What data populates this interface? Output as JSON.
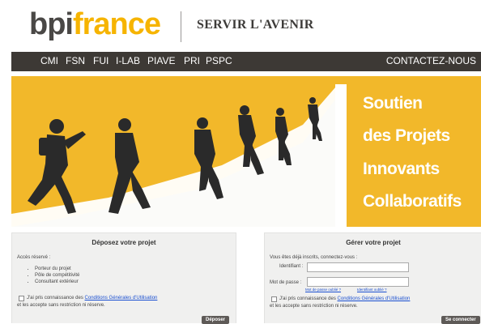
{
  "header": {
    "logo_bpi": "bpi",
    "logo_france": "france",
    "tagline": "SERVIR L'AVENIR"
  },
  "nav": {
    "items": [
      "CMI",
      "FSN",
      "FUI",
      "I-LAB",
      "PIAVE",
      "PRI",
      "PSPC"
    ],
    "contact": "CONTACTEZ-NOUS"
  },
  "banner": {
    "lines": [
      "Soutien",
      "des Projets",
      "Innovants",
      "Collaboratifs"
    ]
  },
  "left_panel": {
    "title": "Déposez votre projet",
    "access_label": "Accès réservé :",
    "bullets": [
      "Porteur du projet",
      "Pôle de compétitivité",
      "Consultant extérieur"
    ],
    "consent_text": "J'ai pris connaissance des",
    "consent_link": "Conditions Générales d'Utilisation",
    "consent_tail": "et les accepte sans restriction ni réserve.",
    "button": "Déposer"
  },
  "right_panel": {
    "title": "Gérer votre projet",
    "intro": "Vous êtes déjà inscrits, connectez-vous :",
    "identifiant_label": "Identifiant :",
    "password_label": "Mot de passe :",
    "forgot_password": "Mot de passe oublié ?",
    "forgot_id": "Identifiant oublié ?",
    "consent_text": "J'ai pris connaissance des",
    "consent_link": "Conditions Générales d'Utilisation",
    "consent_tail": "et les accepte sans restriction ni réserve.",
    "button": "Se connecter"
  },
  "colors": {
    "brand_yellow": "#f6b400",
    "nav_bg": "#3d3935",
    "banner_bg": "#f2b82a"
  }
}
